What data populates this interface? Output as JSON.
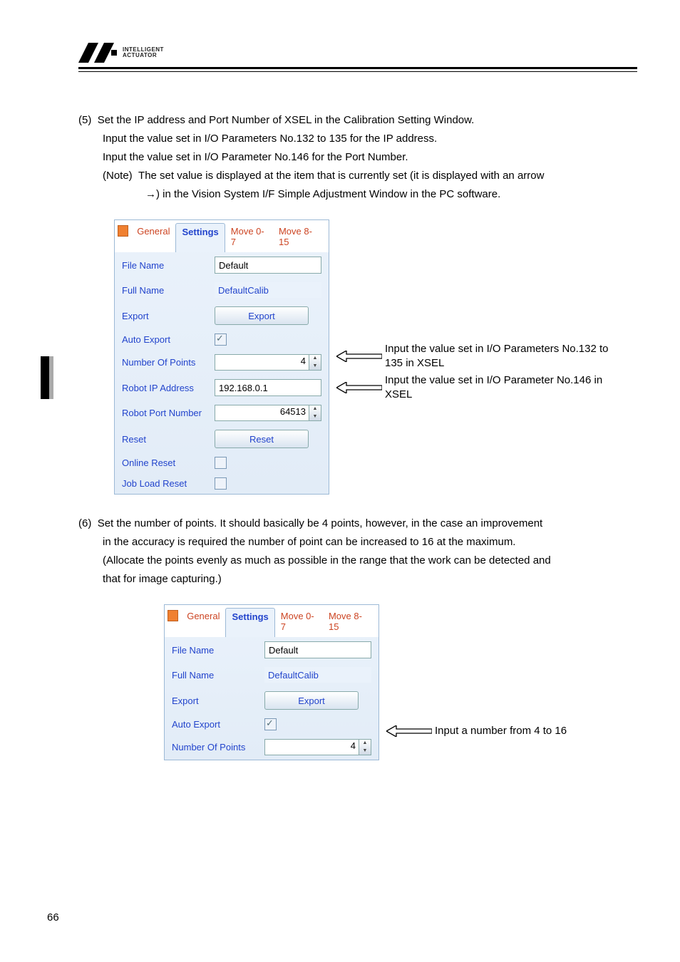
{
  "logo": {
    "line1": "INTELLIGENT",
    "line2": "ACTUATOR"
  },
  "para5": {
    "num": "(5)",
    "line1": "Set the IP address and Port Number of XSEL in the Calibration Setting Window.",
    "line2": "Input the value set in I/O Parameters No.132 to 135 for the IP address.",
    "line3": "Input the value set in I/O Parameter No.146 for the Port Number.",
    "note_lbl": "(Note)",
    "note1": "The set value is displayed at the item that is currently set (it is displayed with an arrow",
    "note2": "→) in the Vision System I/F Simple Adjustment Window in the PC software."
  },
  "panel": {
    "tabs": {
      "general": "General",
      "settings": "Settings",
      "move07": "Move 0-7",
      "move815": "Move 8-15"
    },
    "rows": {
      "file_name_lbl": "File Name",
      "file_name_val": "Default",
      "full_name_lbl": "Full Name",
      "full_name_val": "DefaultCalib",
      "export_lbl": "Export",
      "export_btn": "Export",
      "auto_export_lbl": "Auto Export",
      "num_points_lbl": "Number Of Points",
      "num_points_val": "4",
      "ip_lbl": "Robot IP Address",
      "ip_val": "192.168.0.1",
      "port_lbl": "Robot Port Number",
      "port_val": "64513",
      "reset_lbl": "Reset",
      "reset_btn": "Reset",
      "online_reset_lbl": "Online Reset",
      "jobload_reset_lbl": "Job Load Reset"
    }
  },
  "callout1": {
    "line1": "Input the value set in I/O Parameters No.132 to",
    "line2": "135 in XSEL"
  },
  "callout2": {
    "line1": "Input the value set in I/O Parameter No.146 in",
    "line2": "XSEL"
  },
  "para6": {
    "num": "(6)",
    "line1": "Set the number of points. It should basically be 4 points, however, in the case an improvement",
    "line2": "in the accuracy is required the number of point can be increased to 16 at the maximum.",
    "line3": "(Allocate the points evenly as much as possible in the range that the work can be detected and",
    "line4": "that for image capturing.)"
  },
  "callout3": "Input a number from 4 to 16",
  "page_number": "66"
}
